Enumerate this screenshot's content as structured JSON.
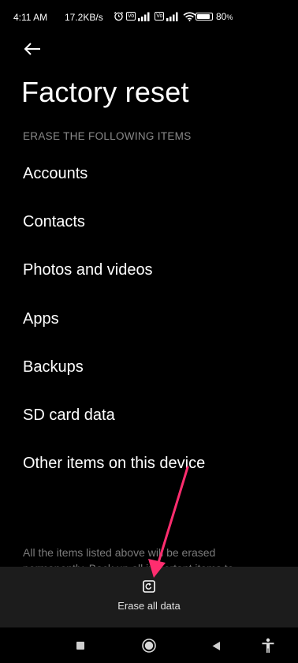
{
  "status_bar": {
    "time": "4:11 AM",
    "network_speed": "17.2KB/s",
    "battery_level": "80",
    "battery_percent_sign": "%"
  },
  "header": {
    "title": "Factory reset"
  },
  "section": {
    "header": "ERASE THE FOLLOWING ITEMS",
    "items": [
      "Accounts",
      "Contacts",
      "Photos and videos",
      "Apps",
      "Backups",
      "SD card data",
      "Other items on this device"
    ]
  },
  "footer_note": "All the items listed above will be erased permanently. Back up all important items to",
  "action": {
    "erase_label": "Erase all data"
  },
  "colors": {
    "background": "#000000",
    "text_primary": "#ffffff",
    "text_secondary": "#8a8a8a",
    "action_bar": "#1c1c1c",
    "annotation_arrow": "#ff2d6f"
  }
}
